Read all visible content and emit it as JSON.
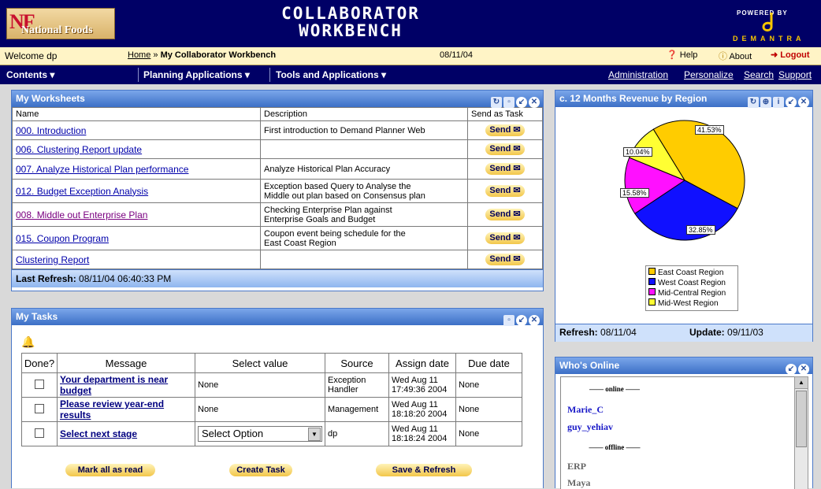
{
  "header": {
    "logo_nf": "NF",
    "logo_text": "National Foods",
    "title_line1": "COLLABORATOR",
    "title_line2": "WORKBENCH",
    "powered_by": "POWERED BY",
    "brand": "DEMANTRA"
  },
  "topbar": {
    "welcome": "Welcome dp",
    "crumb_home": "Home",
    "crumb_sep": "»",
    "crumb_current": "My Collaborator Workbench",
    "date": "08/11/04",
    "help": "Help",
    "about": "About",
    "logout": "Logout"
  },
  "menu": {
    "contents": "Contents",
    "planning": "Planning Applications",
    "tools": "Tools and Applications",
    "administration": "Administration",
    "personalize": "Personalize",
    "search": "Search",
    "support": "Support"
  },
  "worksheets": {
    "title": "My Worksheets",
    "headers": {
      "name": "Name",
      "description": "Description",
      "send": "Send as Task"
    },
    "send_label": "Send",
    "rows": [
      {
        "name": "000. Introduction",
        "desc1": "First introduction to Demand Planner Web",
        "desc2": ""
      },
      {
        "name": "006. Clustering Report update",
        "desc1": "",
        "desc2": ""
      },
      {
        "name": "007. Analyze Historical Plan performance",
        "desc1": "Analyze Historical Plan Accuracy",
        "desc2": ""
      },
      {
        "name": "012. Budget Exception Analysis",
        "desc1": "Exception based Query to Analyse the",
        "desc2": "Middle out plan based on Consensus plan"
      },
      {
        "name": "008. Middle out Enterprise Plan",
        "desc1": "Checking Enterprise Plan against",
        "desc2": "Enterprise Goals and Budget"
      },
      {
        "name": "015. Coupon Program",
        "desc1": "Coupon event being schedule for the",
        "desc2": "East Coast Region"
      },
      {
        "name": "Clustering Report",
        "desc1": "",
        "desc2": ""
      }
    ],
    "refresh_label": "Last Refresh:",
    "refresh_value": "08/11/04 06:40:33 PM"
  },
  "tasks": {
    "title": "My Tasks",
    "headers": {
      "done": "Done?",
      "message": "Message",
      "value": "Select value",
      "source": "Source",
      "assign": "Assign date",
      "due": "Due date"
    },
    "rows": [
      {
        "msg1": "Your department is near",
        "msg2": "budget",
        "value": "None",
        "src1": "Exception",
        "src2": "Handler",
        "assign1": "Wed Aug 11",
        "assign2": "17:49:36 2004",
        "due": "None"
      },
      {
        "msg1": "Please review year-end",
        "msg2": "results",
        "value": "None",
        "src1": "Management",
        "src2": "",
        "assign1": "Wed Aug 11",
        "assign2": "18:18:20 2004",
        "due": "None"
      },
      {
        "msg1": "Select next stage",
        "msg2": "",
        "value": "Select Option",
        "src1": "dp",
        "src2": "",
        "assign1": "Wed Aug 11",
        "assign2": "18:18:24 2004",
        "due": "None"
      }
    ],
    "buttons": {
      "mark_read": "Mark all as read",
      "create": "Create Task",
      "save_refresh": "Save & Refresh"
    }
  },
  "revenue": {
    "title": "c. 12 Months Revenue by Region",
    "refresh_label": "Refresh:",
    "refresh_value": "08/11/04",
    "update_label": "Update:",
    "update_value": "09/11/03"
  },
  "chart_data": {
    "type": "pie",
    "categories": [
      "East Coast Region",
      "West Coast Region",
      "Mid-Central Region",
      "Mid-West Region"
    ],
    "values": [
      41.53,
      32.85,
      15.58,
      10.04
    ],
    "labels": [
      "41.53%",
      "32.85%",
      "15.58%",
      "10.04%"
    ],
    "colors": [
      "#ffcc00",
      "#1010ff",
      "#ff10ff",
      "#ffff33"
    ],
    "legend": "bottom"
  },
  "online": {
    "title": "Who's Online",
    "online_label": "online",
    "offline_label": "offline",
    "online_users": [
      "Marie_C",
      "guy_yehiav"
    ],
    "offline_users": [
      "ERP",
      "Maya"
    ]
  }
}
